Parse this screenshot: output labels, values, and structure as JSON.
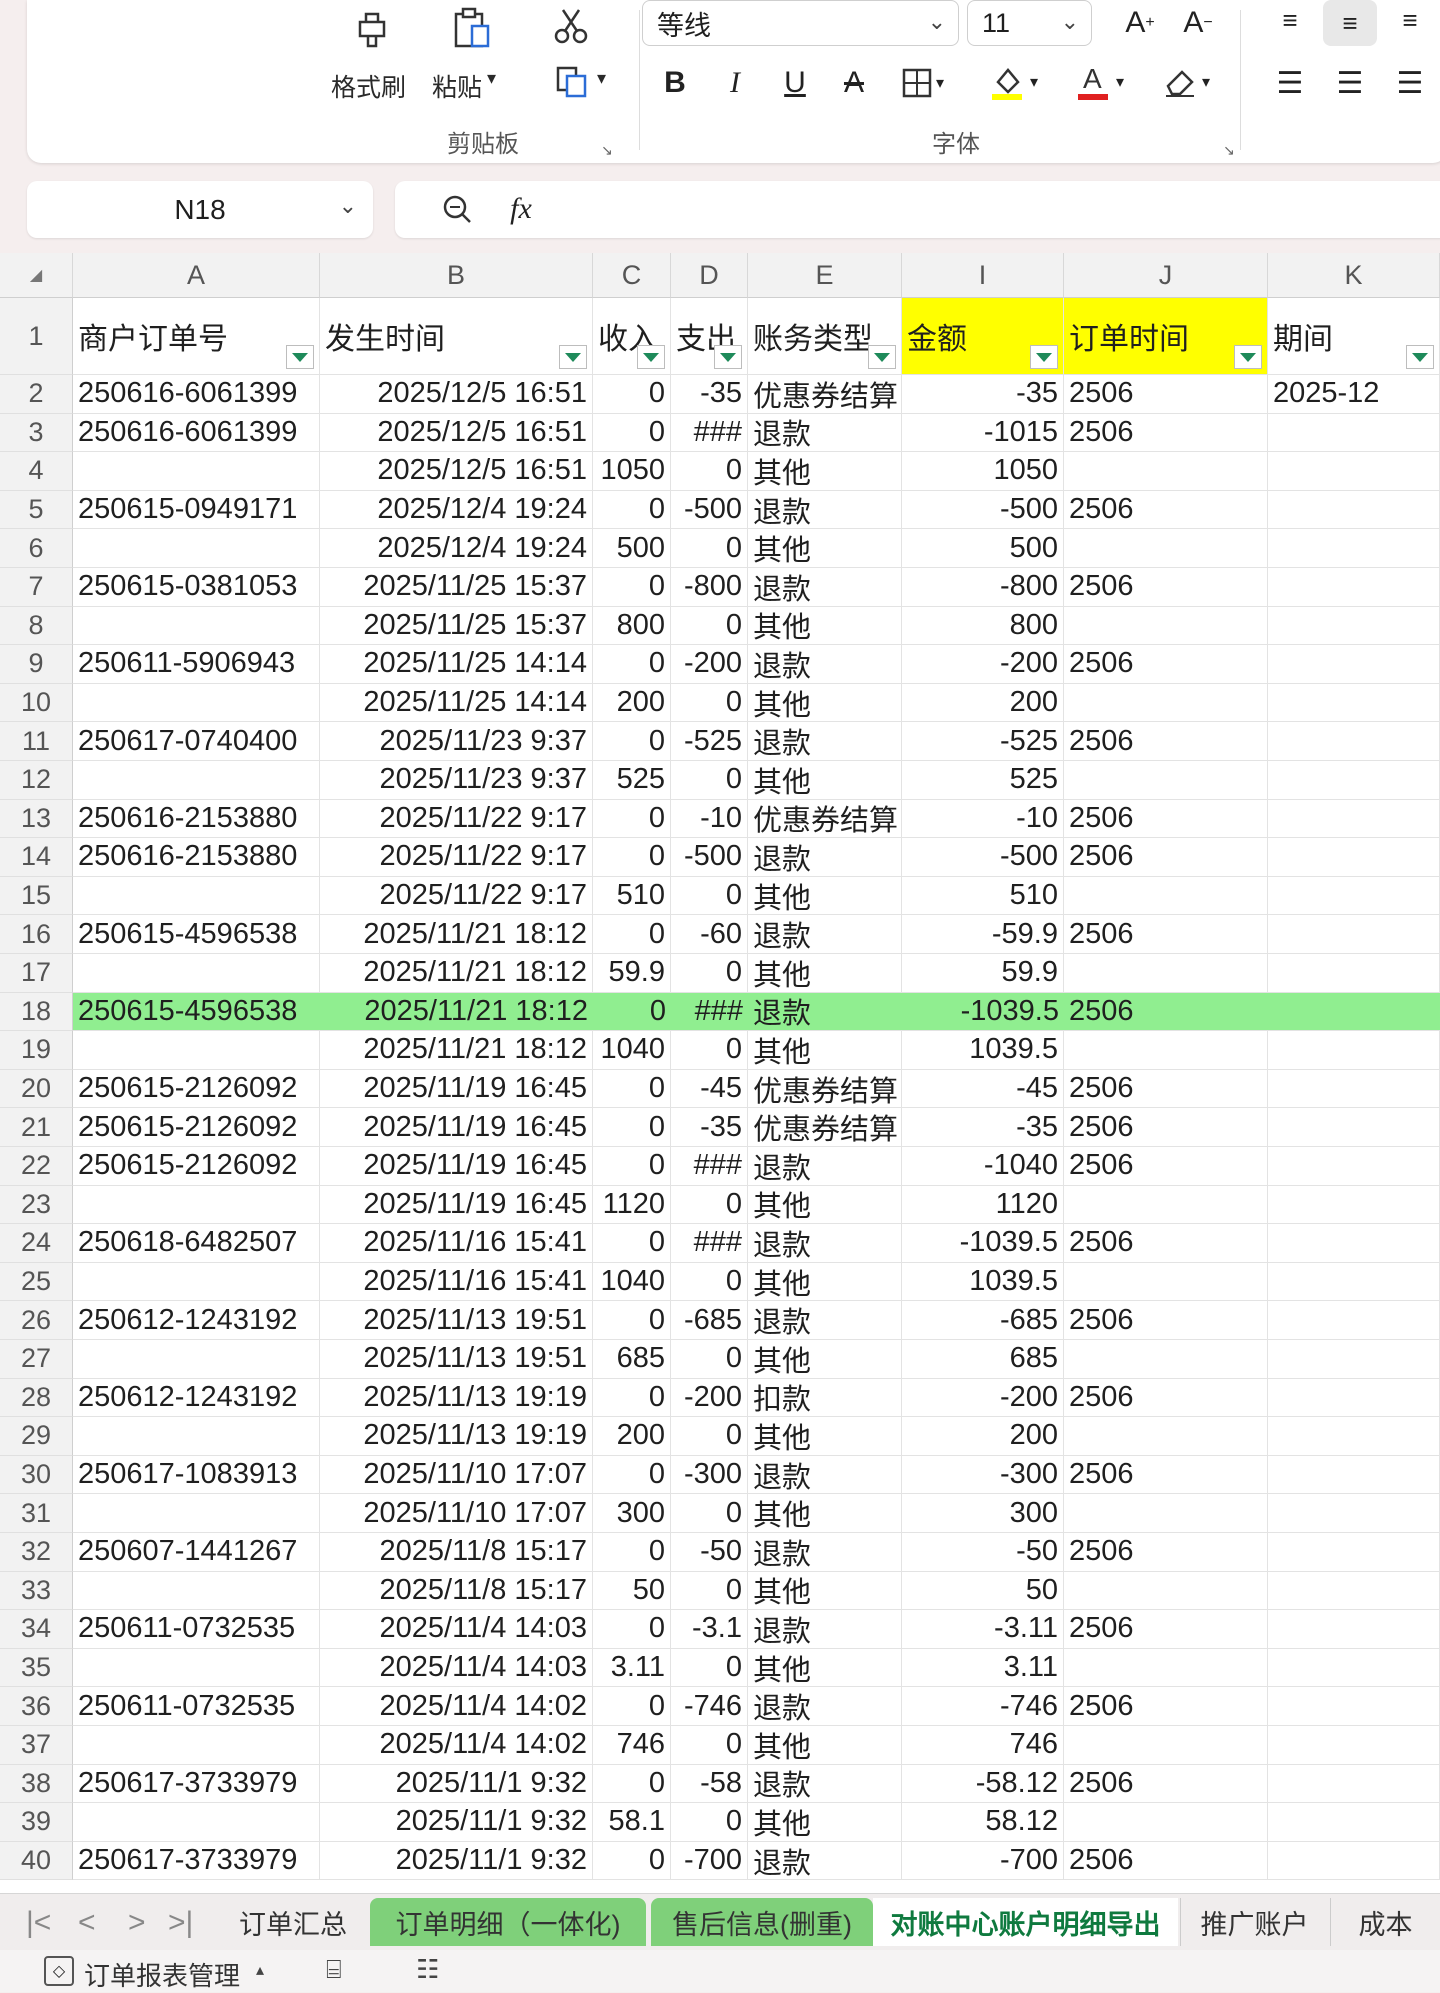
{
  "ribbon": {
    "format_painter": "格式刷",
    "paste": "粘贴",
    "clipboard_group": "剪贴板",
    "font_group": "字体",
    "font_name": "等线",
    "font_size": "11",
    "bold": "B",
    "italic": "I",
    "underline": "U"
  },
  "formula_bar": {
    "name_box": "N18",
    "fx": "fx",
    "content": ""
  },
  "columns": [
    "A",
    "B",
    "C",
    "D",
    "E",
    "I",
    "J",
    "K"
  ],
  "headers": [
    "商户订单号",
    "发生时间",
    "收入",
    "支出",
    "账务类型",
    "金额",
    "订单时间",
    "期间"
  ],
  "highlight_color": "#ffff00",
  "selected_row_color": "#90ee90",
  "rows": [
    {
      "n": "2",
      "a": "250616-6061399",
      "b": "2025/12/5 16:51",
      "c": "0",
      "d": "-35",
      "e": "优惠券结算",
      "i": "-35",
      "j": "2506",
      "k": "2025-12"
    },
    {
      "n": "3",
      "a": "250616-6061399",
      "b": "2025/12/5 16:51",
      "c": "0",
      "d": "###",
      "e": "退款",
      "i": "-1015",
      "j": "2506",
      "k": ""
    },
    {
      "n": "4",
      "a": "",
      "b": "2025/12/5 16:51",
      "c": "1050",
      "d": "0",
      "e": "其他",
      "i": "1050",
      "j": "",
      "k": ""
    },
    {
      "n": "5",
      "a": "250615-0949171",
      "b": "2025/12/4 19:24",
      "c": "0",
      "d": "-500",
      "e": "退款",
      "i": "-500",
      "j": "2506",
      "k": ""
    },
    {
      "n": "6",
      "a": "",
      "b": "2025/12/4 19:24",
      "c": "500",
      "d": "0",
      "e": "其他",
      "i": "500",
      "j": "",
      "k": ""
    },
    {
      "n": "7",
      "a": "250615-0381053",
      "b": "2025/11/25 15:37",
      "c": "0",
      "d": "-800",
      "e": "退款",
      "i": "-800",
      "j": "2506",
      "k": ""
    },
    {
      "n": "8",
      "a": "",
      "b": "2025/11/25 15:37",
      "c": "800",
      "d": "0",
      "e": "其他",
      "i": "800",
      "j": "",
      "k": ""
    },
    {
      "n": "9",
      "a": "250611-5906943",
      "b": "2025/11/25 14:14",
      "c": "0",
      "d": "-200",
      "e": "退款",
      "i": "-200",
      "j": "2506",
      "k": ""
    },
    {
      "n": "10",
      "a": "",
      "b": "2025/11/25 14:14",
      "c": "200",
      "d": "0",
      "e": "其他",
      "i": "200",
      "j": "",
      "k": ""
    },
    {
      "n": "11",
      "a": "250617-0740400",
      "b": "2025/11/23 9:37",
      "c": "0",
      "d": "-525",
      "e": "退款",
      "i": "-525",
      "j": "2506",
      "k": ""
    },
    {
      "n": "12",
      "a": "",
      "b": "2025/11/23 9:37",
      "c": "525",
      "d": "0",
      "e": "其他",
      "i": "525",
      "j": "",
      "k": ""
    },
    {
      "n": "13",
      "a": "250616-2153880",
      "b": "2025/11/22 9:17",
      "c": "0",
      "d": "-10",
      "e": "优惠券结算",
      "i": "-10",
      "j": "2506",
      "k": ""
    },
    {
      "n": "14",
      "a": "250616-2153880",
      "b": "2025/11/22 9:17",
      "c": "0",
      "d": "-500",
      "e": "退款",
      "i": "-500",
      "j": "2506",
      "k": ""
    },
    {
      "n": "15",
      "a": "",
      "b": "2025/11/22 9:17",
      "c": "510",
      "d": "0",
      "e": "其他",
      "i": "510",
      "j": "",
      "k": ""
    },
    {
      "n": "16",
      "a": "250615-4596538",
      "b": "2025/11/21 18:12",
      "c": "0",
      "d": "-60",
      "e": "退款",
      "i": "-59.9",
      "j": "2506",
      "k": ""
    },
    {
      "n": "17",
      "a": "",
      "b": "2025/11/21 18:12",
      "c": "59.9",
      "d": "0",
      "e": "其他",
      "i": "59.9",
      "j": "",
      "k": ""
    },
    {
      "n": "18",
      "a": "250615-4596538",
      "b": "2025/11/21 18:12",
      "c": "0",
      "d": "###",
      "e": "退款",
      "i": "-1039.5",
      "j": "2506",
      "k": "",
      "sel": true
    },
    {
      "n": "19",
      "a": "",
      "b": "2025/11/21 18:12",
      "c": "1040",
      "d": "0",
      "e": "其他",
      "i": "1039.5",
      "j": "",
      "k": ""
    },
    {
      "n": "20",
      "a": "250615-2126092",
      "b": "2025/11/19 16:45",
      "c": "0",
      "d": "-45",
      "e": "优惠券结算",
      "i": "-45",
      "j": "2506",
      "k": ""
    },
    {
      "n": "21",
      "a": "250615-2126092",
      "b": "2025/11/19 16:45",
      "c": "0",
      "d": "-35",
      "e": "优惠券结算",
      "i": "-35",
      "j": "2506",
      "k": ""
    },
    {
      "n": "22",
      "a": "250615-2126092",
      "b": "2025/11/19 16:45",
      "c": "0",
      "d": "###",
      "e": "退款",
      "i": "-1040",
      "j": "2506",
      "k": ""
    },
    {
      "n": "23",
      "a": "",
      "b": "2025/11/19 16:45",
      "c": "1120",
      "d": "0",
      "e": "其他",
      "i": "1120",
      "j": "",
      "k": ""
    },
    {
      "n": "24",
      "a": "250618-6482507",
      "b": "2025/11/16 15:41",
      "c": "0",
      "d": "###",
      "e": "退款",
      "i": "-1039.5",
      "j": "2506",
      "k": ""
    },
    {
      "n": "25",
      "a": "",
      "b": "2025/11/16 15:41",
      "c": "1040",
      "d": "0",
      "e": "其他",
      "i": "1039.5",
      "j": "",
      "k": ""
    },
    {
      "n": "26",
      "a": "250612-1243192",
      "b": "2025/11/13 19:51",
      "c": "0",
      "d": "-685",
      "e": "退款",
      "i": "-685",
      "j": "2506",
      "k": ""
    },
    {
      "n": "27",
      "a": "",
      "b": "2025/11/13 19:51",
      "c": "685",
      "d": "0",
      "e": "其他",
      "i": "685",
      "j": "",
      "k": ""
    },
    {
      "n": "28",
      "a": "250612-1243192",
      "b": "2025/11/13 19:19",
      "c": "0",
      "d": "-200",
      "e": "扣款",
      "i": "-200",
      "j": "2506",
      "k": ""
    },
    {
      "n": "29",
      "a": "",
      "b": "2025/11/13 19:19",
      "c": "200",
      "d": "0",
      "e": "其他",
      "i": "200",
      "j": "",
      "k": ""
    },
    {
      "n": "30",
      "a": "250617-1083913",
      "b": "2025/11/10 17:07",
      "c": "0",
      "d": "-300",
      "e": "退款",
      "i": "-300",
      "j": "2506",
      "k": ""
    },
    {
      "n": "31",
      "a": "",
      "b": "2025/11/10 17:07",
      "c": "300",
      "d": "0",
      "e": "其他",
      "i": "300",
      "j": "",
      "k": ""
    },
    {
      "n": "32",
      "a": "250607-1441267",
      "b": "2025/11/8 15:17",
      "c": "0",
      "d": "-50",
      "e": "退款",
      "i": "-50",
      "j": "2506",
      "k": ""
    },
    {
      "n": "33",
      "a": "",
      "b": "2025/11/8 15:17",
      "c": "50",
      "d": "0",
      "e": "其他",
      "i": "50",
      "j": "",
      "k": ""
    },
    {
      "n": "34",
      "a": "250611-0732535",
      "b": "2025/11/4 14:03",
      "c": "0",
      "d": "-3.1",
      "e": "退款",
      "i": "-3.11",
      "j": "2506",
      "k": ""
    },
    {
      "n": "35",
      "a": "",
      "b": "2025/11/4 14:03",
      "c": "3.11",
      "d": "0",
      "e": "其他",
      "i": "3.11",
      "j": "",
      "k": ""
    },
    {
      "n": "36",
      "a": "250611-0732535",
      "b": "2025/11/4 14:02",
      "c": "0",
      "d": "-746",
      "e": "退款",
      "i": "-746",
      "j": "2506",
      "k": ""
    },
    {
      "n": "37",
      "a": "",
      "b": "2025/11/4 14:02",
      "c": "746",
      "d": "0",
      "e": "其他",
      "i": "746",
      "j": "",
      "k": ""
    },
    {
      "n": "38",
      "a": "250617-3733979",
      "b": "2025/11/1 9:32",
      "c": "0",
      "d": "-58",
      "e": "退款",
      "i": "-58.12",
      "j": "2506",
      "k": ""
    },
    {
      "n": "39",
      "a": "",
      "b": "2025/11/1 9:32",
      "c": "58.1",
      "d": "0",
      "e": "其他",
      "i": "58.12",
      "j": "",
      "k": ""
    },
    {
      "n": "40",
      "a": "250617-3733979",
      "b": "2025/11/1 9:32",
      "c": "0",
      "d": "-700",
      "e": "退款",
      "i": "-700",
      "j": "2506",
      "k": ""
    }
  ],
  "sheet_tabs": [
    "订单汇总",
    "订单明细（一体化)",
    "售后信息(删重)",
    "对账中心账户明细导出",
    "推广账户",
    "成本"
  ],
  "active_tab": "对账中心账户明细导出",
  "status": {
    "macro": "订单报表管理"
  }
}
